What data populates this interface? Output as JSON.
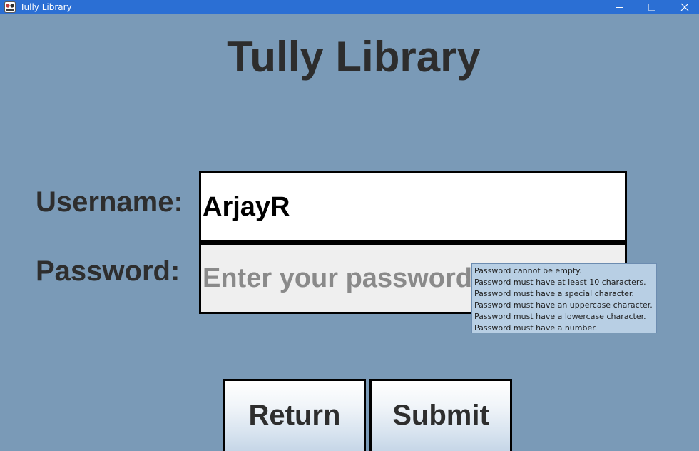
{
  "window": {
    "title": "Tully Library",
    "icon": "library-app-icon",
    "controls": {
      "minimize_icon": "minimize-icon",
      "maximize_icon": "maximize-icon",
      "close_icon": "close-icon"
    }
  },
  "page": {
    "heading": "Tully Library"
  },
  "form": {
    "username_label": "Username:",
    "username_value": "ArjayR",
    "password_label": "Password:",
    "password_placeholder": "Enter your password",
    "password_value": ""
  },
  "tooltip": {
    "lines": [
      "Password cannot be empty.",
      "Password must have at least 10 characters.",
      "Password must have a special character.",
      "Password must have an uppercase character.",
      "Password must have a lowercase character.",
      "Password must have a number."
    ]
  },
  "buttons": {
    "return_label": "Return",
    "submit_label": "Submit"
  },
  "colors": {
    "background": "#7a9ab7",
    "titlebar": "#2b6fd4",
    "tooltip_background": "#b8cfe4",
    "text_dark": "#2e2e2e"
  }
}
